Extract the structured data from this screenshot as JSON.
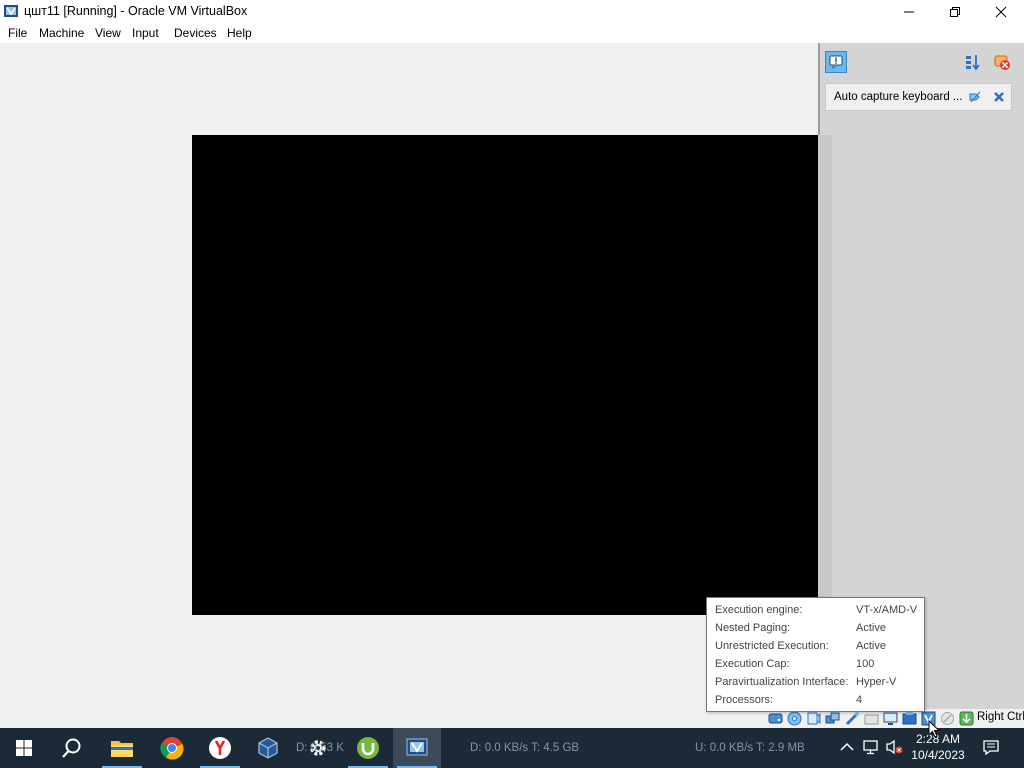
{
  "window": {
    "title": "цшт11 [Running] - Oracle VM VirtualBox"
  },
  "menu": {
    "items": [
      "File",
      "Machine",
      "View",
      "Input",
      "Devices",
      "Help"
    ]
  },
  "notification_center": {
    "message": "Auto capture keyboard ..."
  },
  "tooltip": {
    "rows": [
      {
        "label": "Execution engine:",
        "value": "VT-x/AMD-V"
      },
      {
        "label": "Nested Paging:",
        "value": "Active"
      },
      {
        "label": "Unrestricted Execution:",
        "value": "Active"
      },
      {
        "label": "Execution Cap:",
        "value": "100"
      },
      {
        "label": "Paravirtualization Interface:",
        "value": "Hyper-V"
      },
      {
        "label": "Processors:",
        "value": "4"
      }
    ]
  },
  "statusbar": {
    "host_key": "Right Ctrl"
  },
  "taskbar": {
    "disk_read": "D: 0.0 KB/s T: 4.5 GB",
    "disk_upload": "U: 0.0 KB/s T: 2.9 MB",
    "disk_partial": "D: 0.53 K",
    "clock_time": "2:28 AM",
    "clock_date": "10/4/2023"
  },
  "colors": {
    "taskbar_bg": "#1c2a38",
    "vm_screen": "#000000",
    "accent": "#76b9ed"
  }
}
